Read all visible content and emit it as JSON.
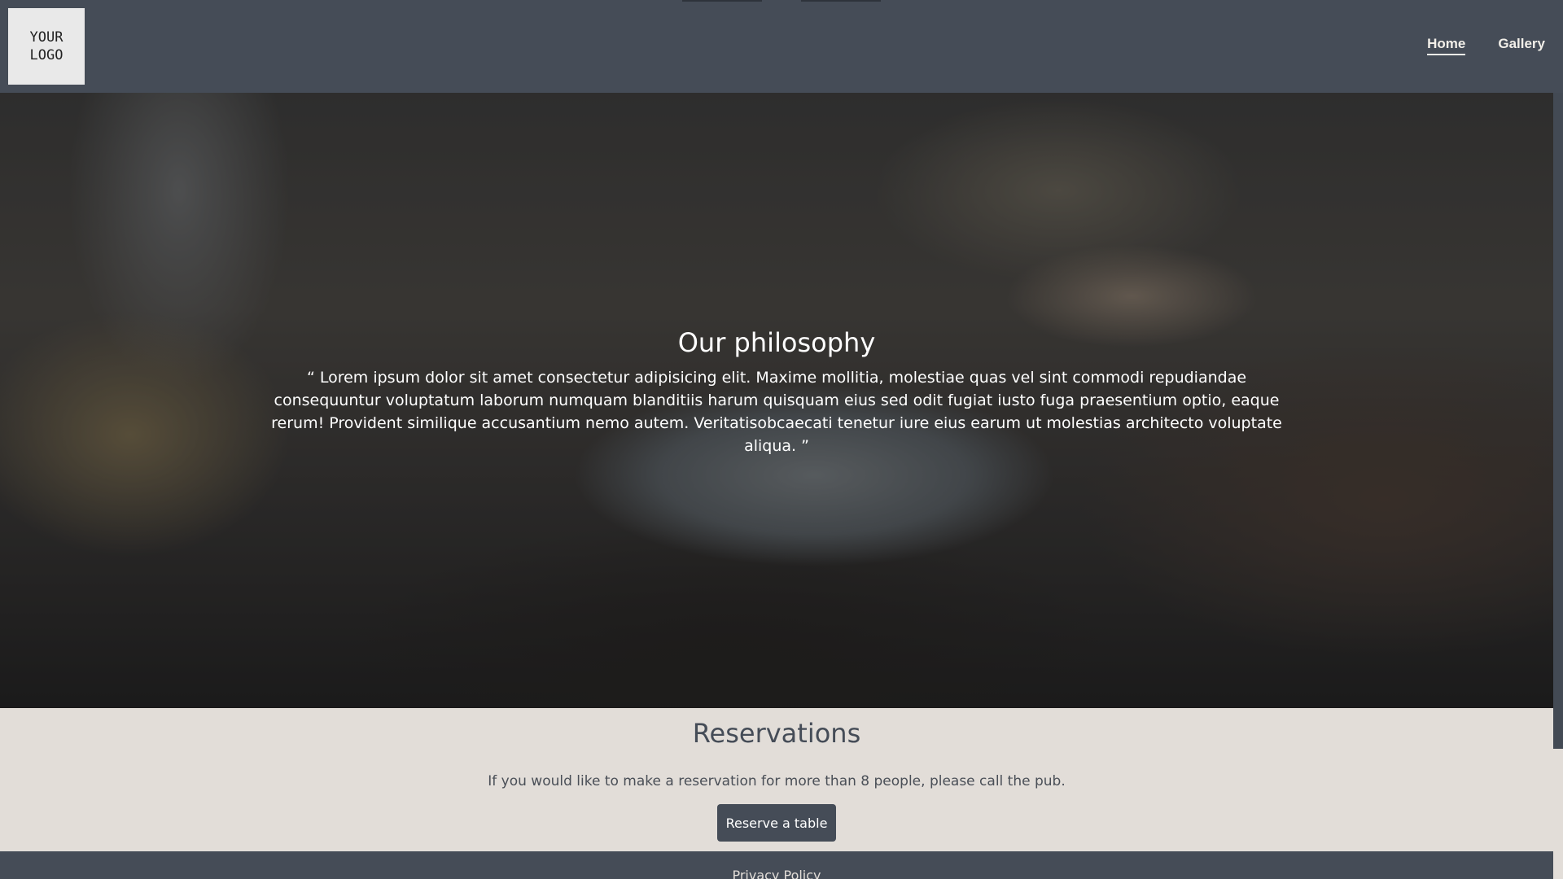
{
  "header": {
    "logo_text": "YOUR LOGO",
    "nav": [
      {
        "label": "Home",
        "active": true
      },
      {
        "label": "Gallery",
        "active": false
      }
    ]
  },
  "hero": {
    "title": "Our philosophy",
    "quote": "“ Lorem ipsum dolor sit amet consectetur adipisicing elit. Maxime mollitia, molestiae quas vel sint commodi repudiandae consequuntur voluptatum laborum numquam blanditiis harum quisquam eius sed odit fugiat iusto fuga praesentium optio, eaque rerum! Provident similique accusantium nemo autem. Veritatisobcaecati tenetur iure eius earum ut molestias architecto voluptate aliqua. ”"
  },
  "reservations": {
    "title": "Reservations",
    "text": "If you would like to make a reservation for more than 8 people, please call the pub.",
    "button_label": "Reserve a table"
  },
  "footer": {
    "link_label": "Privacy Policy"
  },
  "colors": {
    "header_bg": "#454c57",
    "page_bg": "#e2ddd8",
    "button_bg": "#454c57"
  }
}
